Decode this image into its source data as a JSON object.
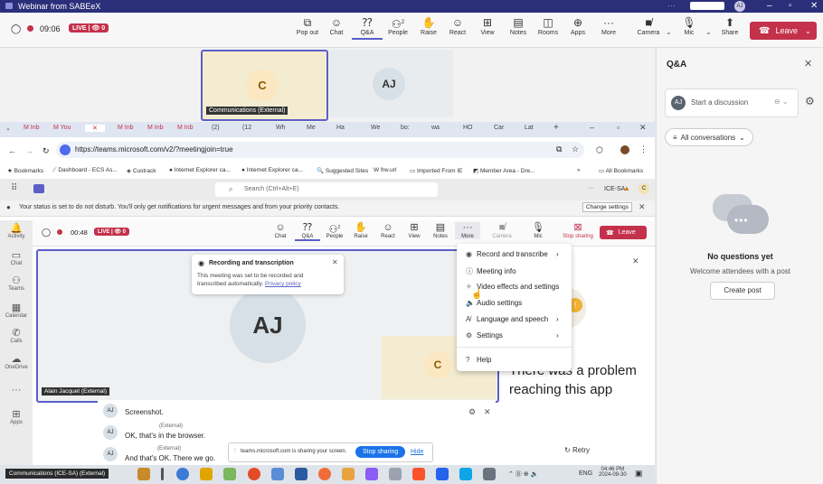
{
  "window": {
    "title": "Webinar from SABEeX",
    "avatar": "AJ"
  },
  "outer_bar": {
    "timer": "09:06",
    "live": "LIVE | 👁 0",
    "buttons": [
      {
        "label": "Pop out",
        "icon": "popout-icon"
      },
      {
        "label": "Chat",
        "icon": "chat-icon"
      },
      {
        "label": "Q&A",
        "icon": "qa-icon"
      },
      {
        "label": "People",
        "icon": "people-icon",
        "count": "2"
      },
      {
        "label": "Raise",
        "icon": "hand-icon"
      },
      {
        "label": "React",
        "icon": "smile-icon"
      },
      {
        "label": "View",
        "icon": "grid-icon"
      },
      {
        "label": "Notes",
        "icon": "notes-icon"
      },
      {
        "label": "Rooms",
        "icon": "rooms-icon"
      },
      {
        "label": "Apps",
        "icon": "apps-icon"
      },
      {
        "label": "More",
        "icon": "more-icon"
      },
      {
        "label": "Camera",
        "icon": "camera-off-icon"
      },
      {
        "label": "Mic",
        "icon": "mic-icon"
      },
      {
        "label": "Share",
        "icon": "share-icon"
      }
    ],
    "leave": "Leave"
  },
  "stage": {
    "tile1": {
      "initial": "C",
      "caption": "Communications (External)"
    },
    "tile2": {
      "initial": "AJ"
    }
  },
  "qa_panel": {
    "title": "Q&A",
    "start_placeholder": "Start a discussion",
    "avatar": "AJ",
    "filter": "All conversations",
    "empty_title": "No questions yet",
    "empty_sub": "Welcome attendees with a post",
    "create": "Create post"
  },
  "browser": {
    "tabs": [
      "M Inb",
      "M You",
      "✕",
      "M Inb",
      "M Inb",
      "M Inb",
      "(2)",
      "(12",
      "Wh",
      "Me",
      "Ha",
      "We",
      "bo:",
      "wa",
      "HO",
      "Car",
      "Lat"
    ],
    "url": "https://teams.microsoft.com/v2/?meetingjoin=true",
    "bookmarks": [
      "Bookmarks",
      "Dashboard - ECS As...",
      "Custrack",
      "Internet Explorer ca...",
      "Internet Explorer ca...",
      "Suggested Sites",
      "frw.url",
      "Imported From IE",
      "Member Area - Dre..."
    ],
    "all_bookmarks": "All Bookmarks"
  },
  "teams": {
    "search_placeholder": "Search (Ctrl+Alt+E)",
    "tenant": "ICE-SA",
    "dnd_text": "Your status is set to do not disturb. You'll only get notifications for urgent messages and from your priority contacts.",
    "change_settings": "Change settings",
    "rail": [
      "Activity",
      "Chat",
      "Teams",
      "Calendar",
      "Calls",
      "OneDrive",
      "",
      "Apps"
    ],
    "meeting": {
      "timer": "00:48",
      "live": "LIVE | 👁 0",
      "buttons": [
        {
          "label": "Chat",
          "icon": "chat-icon"
        },
        {
          "label": "Q&A",
          "icon": "qa-icon"
        },
        {
          "label": "People",
          "icon": "people-icon",
          "count": "2"
        },
        {
          "label": "Raise",
          "icon": "hand-icon"
        },
        {
          "label": "React",
          "icon": "smile-icon"
        },
        {
          "label": "View",
          "icon": "grid-icon"
        },
        {
          "label": "Notes",
          "icon": "notes-icon"
        },
        {
          "label": "More",
          "icon": "more-icon"
        },
        {
          "label": "Camera",
          "icon": "camera-off-icon"
        },
        {
          "label": "Mic",
          "icon": "mic-icon"
        },
        {
          "label": "Stop sharing",
          "icon": "stop-share-icon"
        }
      ],
      "leave": "Leave"
    },
    "toast": {
      "title": "Recording and transcription",
      "body": "This meeting was set to be recorded and transcribed automatically.",
      "link": "Privacy policy"
    },
    "main_avatar": "AJ",
    "main_caption": "Alain Jacquet (External)",
    "small_avatar": "C",
    "menu": [
      {
        "label": "Record and transcribe",
        "icon": "record-icon",
        "sub": true
      },
      {
        "label": "Meeting info",
        "icon": "info-icon",
        "sub": false
      },
      {
        "label": "Video effects and settings",
        "icon": "effects-icon",
        "sub": false
      },
      {
        "label": "Audio settings",
        "icon": "speaker-icon",
        "sub": false
      },
      {
        "label": "Language and speech",
        "icon": "language-icon",
        "sub": true
      },
      {
        "label": "Settings",
        "icon": "gear-icon",
        "sub": true
      },
      {
        "label": "Help",
        "icon": "help-icon",
        "sub": false
      }
    ],
    "chat": [
      {
        "name": "",
        "text": "Screenshot."
      },
      {
        "name": "(External)",
        "text": "OK, that's in the browser."
      },
      {
        "name": "(External)",
        "text": "And that's OK. There we go."
      }
    ],
    "error": "There was a problem reaching this app",
    "retry": "Retry",
    "sharing_text": "teams.microsoft.com is sharing your screen.",
    "stop_sharing": "Stop sharing",
    "hide": "Hide"
  },
  "taskbar": {
    "label": "Communications (ICE-SA) (External)",
    "lang": "ENG",
    "time": "04:46 PM",
    "date": "2024-09-30"
  },
  "colors": {
    "accent": "#5b5fc7",
    "danger": "#c4314b",
    "avatar_c": "#fbe7c1",
    "avatar_aj": "#d6e0e6"
  }
}
